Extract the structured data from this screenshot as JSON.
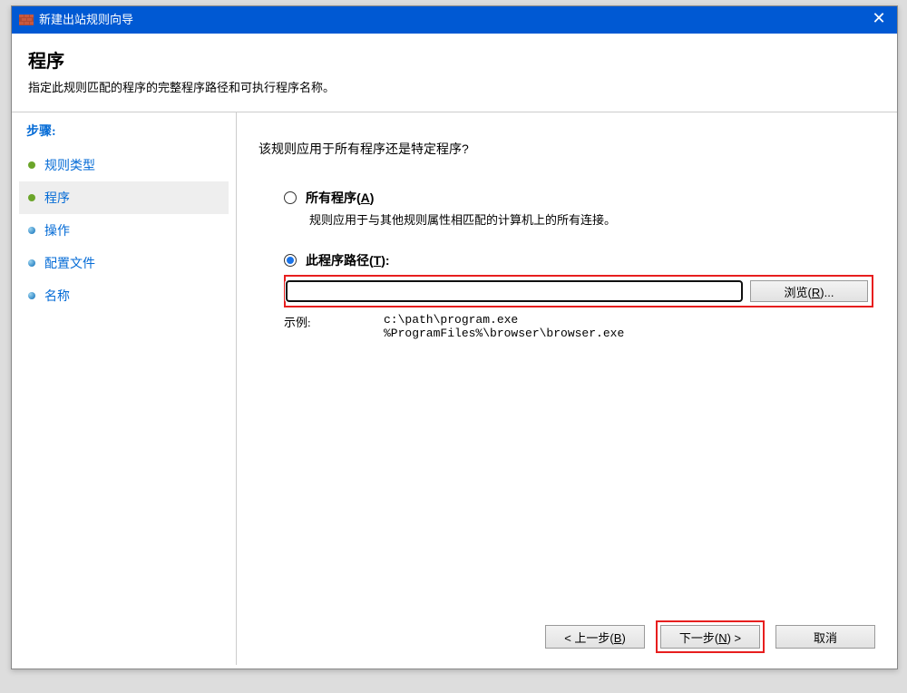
{
  "window": {
    "title": "新建出站规则向导"
  },
  "header": {
    "title": "程序",
    "description": "指定此规则匹配的程序的完整程序路径和可执行程序名称。"
  },
  "sidebar": {
    "heading": "步骤:",
    "steps": [
      {
        "label": "规则类型"
      },
      {
        "label": "程序"
      },
      {
        "label": "操作"
      },
      {
        "label": "配置文件"
      },
      {
        "label": "名称"
      }
    ]
  },
  "main": {
    "question": "该规则应用于所有程序还是特定程序?",
    "option_all": {
      "label_prefix": "所有程序(",
      "hotkey": "A",
      "label_suffix": ")",
      "desc": "规则应用于与其他规则属性相匹配的计算机上的所有连接。"
    },
    "option_path": {
      "label_prefix": "此程序路径(",
      "hotkey": "T",
      "label_suffix": "):"
    },
    "path_input_value": "",
    "browse": {
      "prefix": "浏览(",
      "hotkey": "R",
      "suffix": ")..."
    },
    "example": {
      "label": "示例:",
      "line1": "c:\\path\\program.exe",
      "line2": "%ProgramFiles%\\browser\\browser.exe"
    }
  },
  "footer": {
    "back": {
      "prefix": "< 上一步(",
      "hotkey": "B",
      "suffix": ")"
    },
    "next": {
      "prefix": "下一步(",
      "hotkey": "N",
      "suffix": ") >"
    },
    "cancel": "取消"
  }
}
